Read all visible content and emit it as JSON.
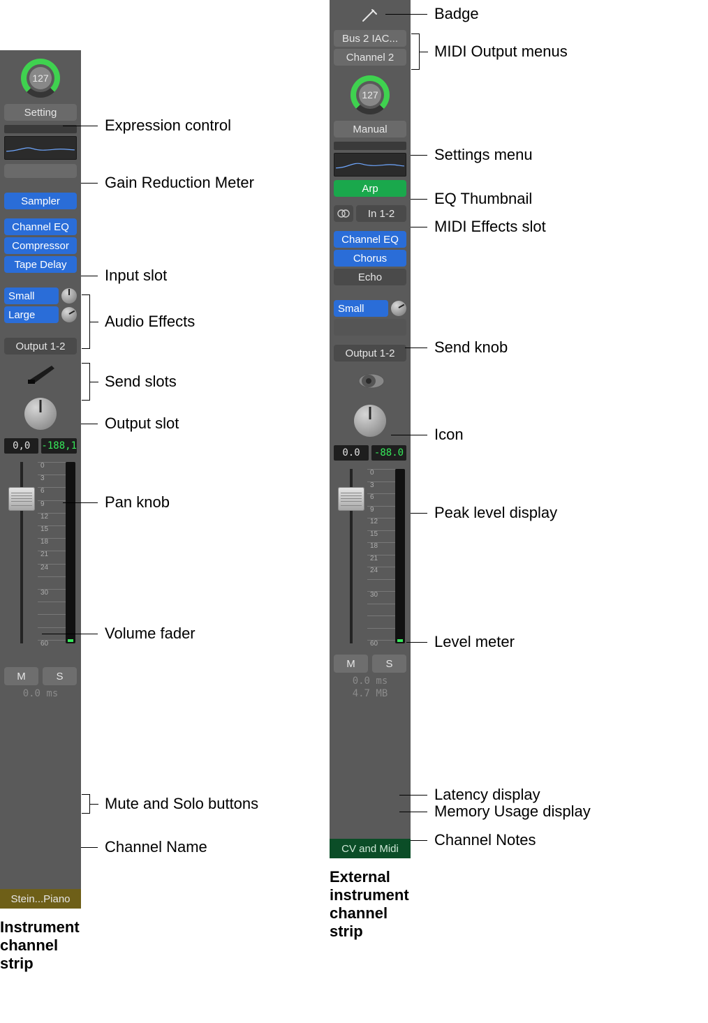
{
  "left": {
    "caption": "Instrument channel strip",
    "expression": "127",
    "setting": "Setting",
    "input_slot": "Sampler",
    "audio_fx": [
      "Channel EQ",
      "Compressor",
      "Tape Delay"
    ],
    "sends": [
      "Small",
      "Large"
    ],
    "output_slot": "Output 1-2",
    "peak_left": "0,0",
    "peak_right": "-188,1",
    "mute": "M",
    "solo": "S",
    "latency": "0.0 ms",
    "channel_name": "Stein...Piano",
    "labels": {
      "expression": "Expression control",
      "gain": "Gain Reduction Meter",
      "input": "Input slot",
      "audiofx": "Audio Effects",
      "sends": "Send slots",
      "output": "Output slot",
      "pan": "Pan knob",
      "fader": "Volume fader",
      "ms": "Mute and Solo buttons",
      "chname": "Channel Name"
    }
  },
  "right": {
    "caption": "External instrument channel strip",
    "midi_out": [
      "Bus 2 IAC...",
      "Channel 2"
    ],
    "expression": "127",
    "setting": "Manual",
    "midi_fx": "Arp",
    "stereo_in": "In 1-2",
    "audio_fx": [
      "Channel EQ",
      "Chorus",
      "Echo"
    ],
    "sends": [
      "Small"
    ],
    "output_slot": "Output 1-2",
    "peak_left": "0.0",
    "peak_right": "-88.0",
    "mute": "M",
    "solo": "S",
    "latency": "0.0 ms",
    "memory": "4.7 MB",
    "channel_notes": "CV and Midi",
    "labels": {
      "badge": "Badge",
      "midiout": "MIDI Output menus",
      "settings": "Settings menu",
      "eq": "EQ Thumbnail",
      "midifx": "MIDI Effects slot",
      "sendknob": "Send knob",
      "icon": "Icon",
      "peak": "Peak level display",
      "meter": "Level meter",
      "latency": "Latency display",
      "memory": "Memory Usage display",
      "notes": "Channel Notes"
    }
  },
  "fader_ticks": [
    "0",
    "3",
    "6",
    "9",
    "12",
    "15",
    "18",
    "21",
    "24",
    "",
    "30",
    "",
    "",
    "",
    "60"
  ]
}
